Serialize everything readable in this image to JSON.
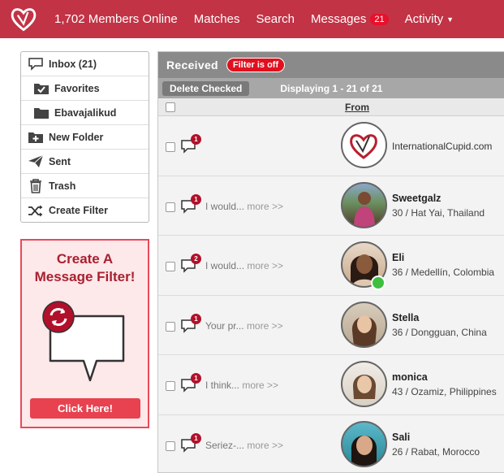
{
  "nav": {
    "members_online": "1,702 Members Online",
    "matches": "Matches",
    "search": "Search",
    "messages": "Messages",
    "messages_count": "21",
    "activity": "Activity"
  },
  "sidebar": {
    "items": [
      {
        "label": "Inbox (21)",
        "icon": "inbox-bubble-icon"
      },
      {
        "label": "Favorites",
        "icon": "favorites-check-icon"
      },
      {
        "label": "Ebavajalikud",
        "icon": "folder-icon"
      },
      {
        "label": "New Folder",
        "icon": "new-folder-icon"
      },
      {
        "label": "Sent",
        "icon": "paper-plane-icon"
      },
      {
        "label": "Trash",
        "icon": "trash-icon"
      },
      {
        "label": "Create Filter",
        "icon": "shuffle-icon"
      }
    ]
  },
  "promo": {
    "title_line1": "Create A",
    "title_line2": "Message Filter!",
    "button": "Click Here!"
  },
  "inbox": {
    "title": "Received",
    "filter_status": "Filter is off",
    "delete_button": "Delete Checked",
    "displaying": "Displaying 1 - 21 of 21",
    "from_header": "From",
    "more_label": "more >>",
    "rows": [
      {
        "count": "1",
        "snippet": "",
        "name": "",
        "site": "InternationalCupid.com",
        "info": "",
        "online": false
      },
      {
        "count": "1",
        "snippet": "I would...",
        "name": "Sweetgalz",
        "site": "",
        "info": "30 / Hat Yai, Thailand",
        "online": false
      },
      {
        "count": "2",
        "snippet": "I would...",
        "name": "Eli",
        "site": "",
        "info": "36 / Medellín, Colombia",
        "online": true
      },
      {
        "count": "1",
        "snippet": "Your pr...",
        "name": "Stella",
        "site": "",
        "info": "36 / Dongguan, China",
        "online": false
      },
      {
        "count": "1",
        "snippet": "I think...",
        "name": "monica",
        "site": "",
        "info": "43 / Ozamiz, Philippines",
        "online": false
      },
      {
        "count": "1",
        "snippet": "Seriez-...",
        "name": "Sali",
        "site": "",
        "info": "26 / Rabat, Morocco",
        "online": false
      }
    ]
  },
  "colors": {
    "brand_red": "#c23345",
    "badge_red": "#b2102a",
    "online_green": "#3fbf3f"
  }
}
